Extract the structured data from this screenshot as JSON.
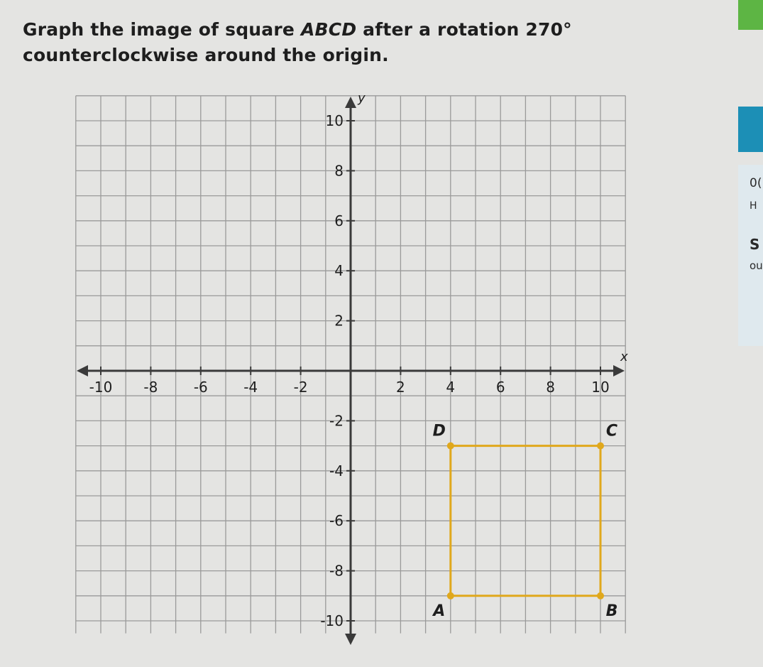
{
  "question": {
    "text_before": "Graph the image of square ",
    "shape_name": "ABCD",
    "text_middle": " after a rotation ",
    "angle": "270°",
    "text_after": " counterclockwise around the origin."
  },
  "graph": {
    "x_range": [
      -10,
      10
    ],
    "y_range": [
      -10,
      10
    ],
    "grid_step": 1,
    "x_axis_label": "x",
    "y_axis_label": "y",
    "x_ticks": [
      {
        "value": -10,
        "label": "-10"
      },
      {
        "value": -8,
        "label": "-8"
      },
      {
        "value": -6,
        "label": "-6"
      },
      {
        "value": -4,
        "label": "-4"
      },
      {
        "value": -2,
        "label": "-2"
      },
      {
        "value": 2,
        "label": "2"
      },
      {
        "value": 4,
        "label": "4"
      },
      {
        "value": 6,
        "label": "6"
      },
      {
        "value": 8,
        "label": "8"
      },
      {
        "value": 10,
        "label": "10"
      }
    ],
    "y_ticks": [
      {
        "value": 10,
        "label": "10"
      },
      {
        "value": 8,
        "label": "8"
      },
      {
        "value": 6,
        "label": "6"
      },
      {
        "value": 4,
        "label": "4"
      },
      {
        "value": 2,
        "label": "2"
      },
      {
        "value": -2,
        "label": "-2"
      },
      {
        "value": -4,
        "label": "-4"
      },
      {
        "value": -6,
        "label": "-6"
      },
      {
        "value": -8,
        "label": "-8"
      },
      {
        "value": -10,
        "label": "-10"
      }
    ],
    "square": {
      "color": "#e0a81c",
      "vertices": [
        {
          "name": "A",
          "x": 4,
          "y": -9
        },
        {
          "name": "B",
          "x": 10,
          "y": -9
        },
        {
          "name": "C",
          "x": 10,
          "y": -3
        },
        {
          "name": "D",
          "x": 4,
          "y": -3
        }
      ]
    }
  },
  "side_panel": {
    "accent_green": "#5db544",
    "accent_teal": "#1c8fb6",
    "panel_bg": "#dfe9ee",
    "text_1": "0(",
    "text_2": "H",
    "text_3": "S",
    "text_4": "ou"
  }
}
